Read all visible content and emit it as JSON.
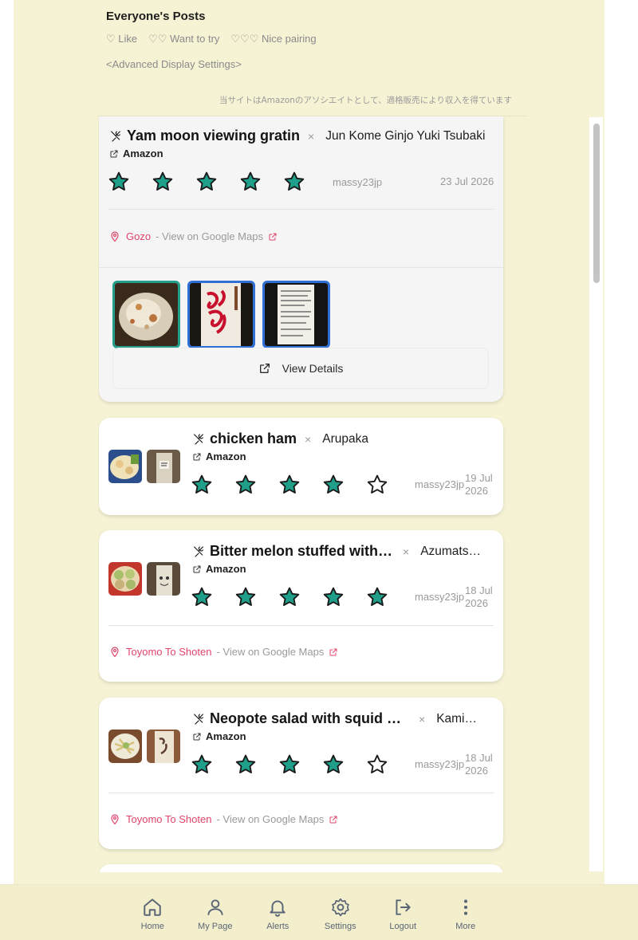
{
  "header": {
    "title": "Everyone's Posts",
    "legend": [
      "♡ Like",
      "♡♡ Want to try",
      "♡♡♡ Nice pairing"
    ],
    "advanced": "<Advanced Display Settings>",
    "disclaimer": "当サイトはAmazonのアソシエイトとして、適格販売により収入を得ています"
  },
  "colors": {
    "background": "#f6f3d5",
    "star_fill": "#1f9e89",
    "shop_link": "#e0446a",
    "photo_border": "#2f6fd6"
  },
  "icons": {
    "dish": "utensils-icon",
    "remove": "close-icon",
    "external": "external-link-icon",
    "location": "map-pin-icon",
    "star_full": "star-filled-icon",
    "star_empty": "star-outline-icon"
  },
  "posts": [
    {
      "dish": "Yam moon viewing gratin",
      "drink": "Jun Kome Ginjo Yuki Tsubaki",
      "amazon": "Amazon",
      "rating": 5,
      "user": "massy23jp",
      "date": "23 Jul 2026",
      "shop": "Gozo",
      "maps_link": "- View on Google Maps",
      "details": "View Details"
    },
    {
      "dish": "chicken ham",
      "drink": "Arupaka",
      "amazon": "Amazon",
      "rating": 4,
      "user": "massy23jp",
      "date_day": "19 Jul",
      "date_year": "2026"
    },
    {
      "dish": "Bitter melon stuffed with …",
      "drink": "Azumats…",
      "amazon": "Amazon",
      "rating": 5,
      "user": "massy23jp",
      "date_day": "18 Jul",
      "date_year": "2026",
      "shop": "Toyomo To Shoten",
      "maps_link": "- View on Google Maps"
    },
    {
      "dish": "Neopote salad with squid m…",
      "drink": "Kami…",
      "amazon": "Amazon",
      "rating": 4,
      "user": "massy23jp",
      "date_day": "18 Jul",
      "date_year": "2026",
      "shop": "Toyomo To Shoten",
      "maps_link": "- View on Google Maps"
    }
  ],
  "nav": {
    "home": "Home",
    "mypage": "My Page",
    "alerts": "Alerts",
    "settings": "Settings",
    "logout": "Logout",
    "more": "More"
  }
}
